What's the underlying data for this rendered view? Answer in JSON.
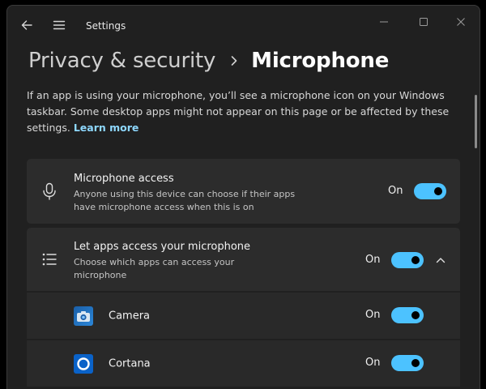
{
  "window": {
    "title": "Settings",
    "back_icon": "back-arrow-icon",
    "menu_icon": "hamburger-menu-icon"
  },
  "breadcrumb": {
    "parent": "Privacy & security",
    "current": "Microphone"
  },
  "description": {
    "text": "If an app is using your microphone, you’ll see a microphone icon on your Windows taskbar. Some desktop apps might not appear on this page or be affected by these settings.",
    "link": "Learn more"
  },
  "microphone_access": {
    "icon": "microphone-icon",
    "title": "Microphone access",
    "subtitle": "Anyone using this device can choose if their apps have microphone access when this is on",
    "state": "On",
    "enabled": true
  },
  "apps_access": {
    "icon": "list-icon",
    "title": "Let apps access your microphone",
    "subtitle": "Choose which apps can access your microphone",
    "state": "On",
    "enabled": true,
    "expanded": true
  },
  "apps": [
    {
      "name": "Camera",
      "icon": "camera-app-icon",
      "state": "On",
      "enabled": true
    },
    {
      "name": "Cortana",
      "icon": "cortana-app-icon",
      "state": "On",
      "enabled": true
    }
  ],
  "colors": {
    "accent": "#4cc2ff",
    "link": "#8ed8ff",
    "background": "#202020",
    "card": "#2c2c2c"
  }
}
